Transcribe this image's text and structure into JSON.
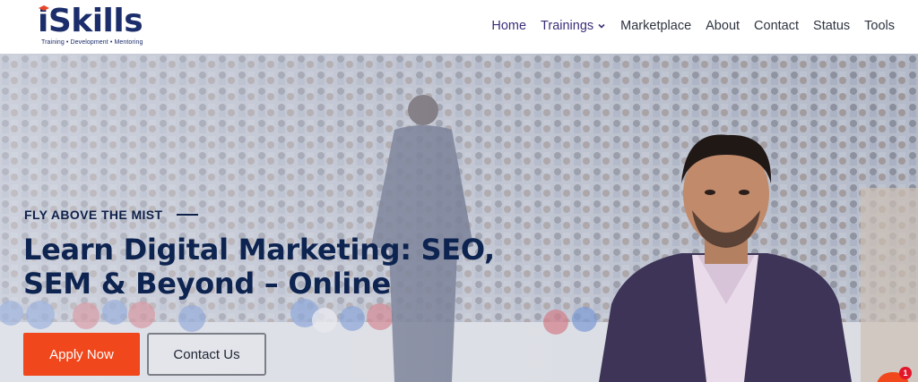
{
  "brand": {
    "name": "iSkills",
    "tagline": "Training • Development • Mentoring"
  },
  "nav": {
    "items": [
      {
        "label": "Home",
        "active": true,
        "has_dropdown": false
      },
      {
        "label": "Trainings",
        "active": false,
        "has_dropdown": true
      },
      {
        "label": "Marketplace",
        "active": false,
        "has_dropdown": false
      },
      {
        "label": "About",
        "active": false,
        "has_dropdown": false
      },
      {
        "label": "Contact",
        "active": false,
        "has_dropdown": false
      },
      {
        "label": "Status",
        "active": false,
        "has_dropdown": false
      },
      {
        "label": "Tools",
        "active": false,
        "has_dropdown": false
      }
    ]
  },
  "hero": {
    "eyebrow": "FLY ABOVE THE MIST",
    "headline_line1": "Learn Digital Marketing: SEO,",
    "headline_line2": "SEM & Beyond – Online",
    "primary_button": "Apply Now",
    "secondary_button": "Contact Us"
  },
  "chat": {
    "badge_count": "1",
    "icon": "chat-bubble-icon"
  },
  "colors": {
    "brand_navy": "#1b2d6b",
    "headline": "#0d2350",
    "accent_orange": "#f1471c",
    "nav_active": "#3c2e7a",
    "badge_red": "#e3162b"
  }
}
